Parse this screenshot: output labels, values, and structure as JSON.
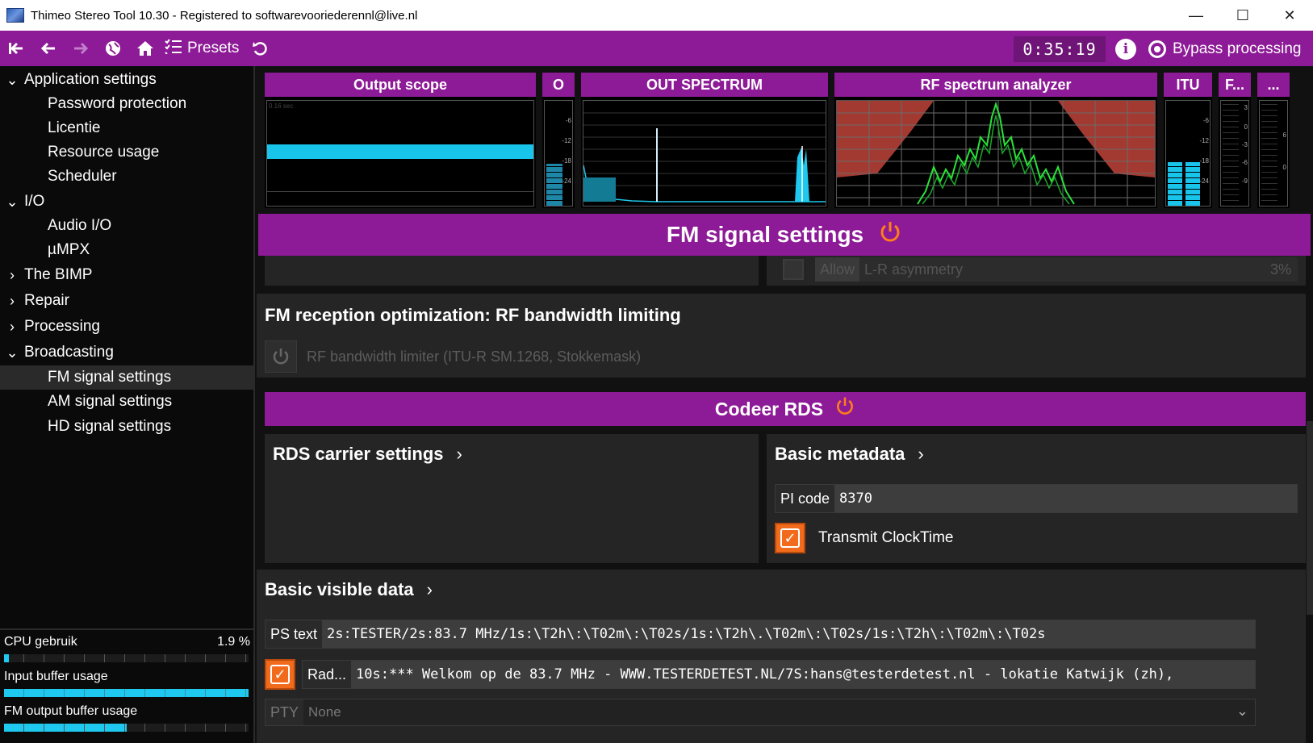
{
  "window": {
    "title": "Thimeo Stereo Tool 10.30 - Registered to softwarevooriederennl@live.nl",
    "minimize": "—",
    "maximize": "☐",
    "close": "✕"
  },
  "toolbar": {
    "presets_label": "Presets",
    "clock": "0:35:19",
    "bypass_label": "Bypass processing"
  },
  "sidebar": {
    "app_settings": "Application settings",
    "password": "Password protection",
    "license": "Licentie",
    "resource": "Resource usage",
    "scheduler": "Scheduler",
    "io": "I/O",
    "audio_io": "Audio I/O",
    "umpx": "µMPX",
    "bimp": "The BIMP",
    "repair": "Repair",
    "processing": "Processing",
    "broadcasting": "Broadcasting",
    "fm": "FM signal settings",
    "am": "AM signal settings",
    "hd": "HD signal settings"
  },
  "status": {
    "cpu_label": "CPU gebruik",
    "cpu_value": "1.9 %",
    "cpu_fraction": 0.019,
    "input_label": "Input buffer usage",
    "input_fraction": 1.0,
    "fm_out_label": "FM output buffer usage",
    "fm_out_fraction": 0.5
  },
  "meters": {
    "output_scope": "Output scope",
    "o": "O",
    "out_spectrum": "OUT SPECTRUM",
    "rf_analyzer": "RF spectrum analyzer",
    "itu": "ITU",
    "f": "F...",
    "more": "...",
    "scope_label": "0.16 sec",
    "o_ticks": [
      "-6",
      "-12",
      "-18",
      "-24"
    ],
    "itu_ticks": [
      "-6",
      "-12",
      "-18",
      "-24"
    ],
    "f_ticks": [
      "3",
      "0",
      "-3",
      "-6",
      "-9"
    ],
    "more_ticks": [
      "6",
      "0"
    ]
  },
  "fm_section": {
    "title": "FM signal settings",
    "allow_label": "Allow",
    "asymmetry_label": "L-R asymmetry",
    "asymmetry_value": "3%",
    "rf_card_title": "FM reception optimization: RF bandwidth limiting",
    "rf_limiter_label": "RF bandwidth limiter (ITU-R SM.1268, Stokkemask)"
  },
  "rds_section": {
    "title": "Codeer RDS",
    "carrier_title": "RDS carrier settings",
    "metadata_title": "Basic metadata",
    "pi_label": "PI code",
    "pi_value": "8370",
    "clocktime_label": "Transmit ClockTime",
    "visible_title": "Basic visible data",
    "ps_label": "PS text",
    "ps_value": "2s:TESTER/2s:83.7 MHz/1s:\\T2h\\:\\T02m\\:\\T02s/1s:\\T2h\\.\\T02m\\:\\T02s/1s:\\T2h\\:\\T02m\\:\\T02s",
    "rt_label": "Rad...",
    "rt_value": "10s:*** Welkom op de 83.7 MHz - WWW.TESTERDETEST.NL/7S:hans@testerdetest.nl - lokatie Katwijk (zh),",
    "pty_label": "PTY",
    "pty_value": "None"
  },
  "colors": {
    "accent": "#8d1a96",
    "orange": "#f26b1d",
    "cyan": "#1ec8ee"
  }
}
